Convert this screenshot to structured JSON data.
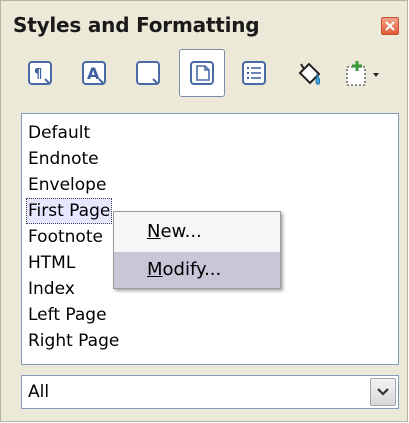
{
  "window": {
    "title": "Styles and Formatting"
  },
  "toolbar": {
    "buttons": [
      {
        "icon": "paragraph-styles-icon"
      },
      {
        "icon": "character-styles-icon"
      },
      {
        "icon": "frame-styles-icon"
      },
      {
        "icon": "page-styles-icon",
        "active": true
      },
      {
        "icon": "list-styles-icon"
      },
      {
        "icon": "fill-format-mode-icon"
      },
      {
        "icon": "new-style-from-selection-icon"
      }
    ]
  },
  "list": {
    "items": [
      "Default",
      "Endnote",
      "Envelope",
      "First Page",
      "Footnote",
      "HTML",
      "Index",
      "Left Page",
      "Right Page"
    ],
    "selected_index": 3
  },
  "context_menu": {
    "items": [
      {
        "accel": "N",
        "rest": "ew..."
      },
      {
        "accel": "M",
        "rest": "odify...",
        "hover": true
      }
    ]
  },
  "filter": {
    "value": "All"
  }
}
